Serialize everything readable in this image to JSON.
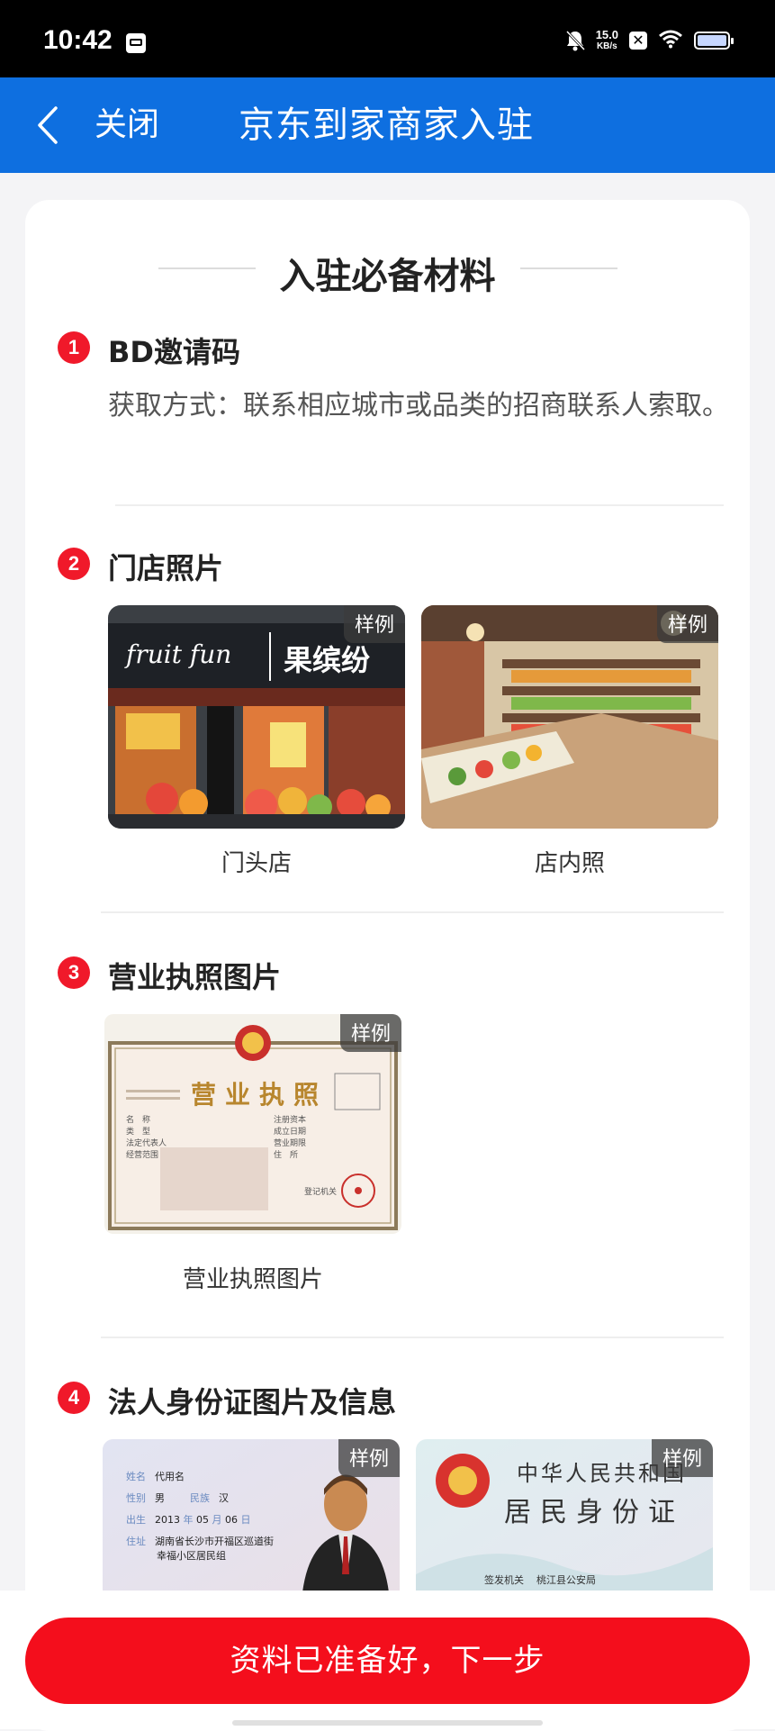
{
  "status_bar": {
    "time": "10:42",
    "speed_value": "15.0",
    "speed_unit": "KB/s"
  },
  "nav": {
    "back_label": "",
    "close_label": "关闭",
    "title": "京东到家商家入驻"
  },
  "main": {
    "title": "入驻必备材料",
    "sample_badge": "样例",
    "sections": [
      {
        "num": "1",
        "title": "BD邀请码",
        "desc": "获取方式：联系相应城市或品类的招商联系人索取。"
      },
      {
        "num": "2",
        "title": "门店照片",
        "photos": [
          {
            "caption": "门头店"
          },
          {
            "caption": "店内照"
          }
        ]
      },
      {
        "num": "3",
        "title": "营业执照图片",
        "photos": [
          {
            "caption": "营业执照图片"
          }
        ]
      },
      {
        "num": "4",
        "title": "法人身份证图片及信息"
      }
    ],
    "store_sign": {
      "brand_en": "fruit fun",
      "brand_cn": "果缤纷"
    },
    "license": {
      "title": "营业执照",
      "rows_left": [
        "名　称",
        "类　型",
        "法定代表人",
        "经营范围"
      ],
      "rows_right": [
        "注册资本",
        "成立日期",
        "营业期限",
        "住　所"
      ],
      "issuer": "登记机关"
    },
    "id_front": {
      "name_label": "姓名",
      "name": "代用名",
      "gender_label": "性别",
      "gender": "男",
      "ethnic_label": "民族",
      "ethnic": "汉",
      "birth_label": "出生",
      "birth_year": "2013",
      "birth_year_unit": "年",
      "birth_month": "05",
      "birth_month_unit": "月",
      "birth_day": "06",
      "birth_day_unit": "日",
      "addr_label": "住址",
      "addr_1": "湖南省长沙市开福区巡道街",
      "addr_2": "幸福小区居民组"
    },
    "id_back": {
      "line1": "中华人民共和国",
      "line2": "居民身份证",
      "issuer_label": "签发机关",
      "issuer": "桃江县公安局"
    }
  },
  "footer": {
    "next_button": "资料已准备好，下一步"
  },
  "colors": {
    "nav_blue": "#0e6fe0",
    "accent_red": "#f40e1c",
    "badge_red": "#f0192a"
  }
}
